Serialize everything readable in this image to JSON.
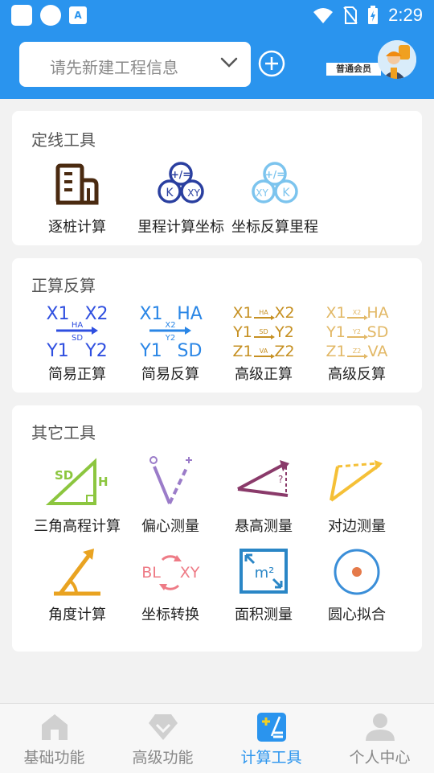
{
  "status_bar": {
    "time": "2:29"
  },
  "header": {
    "project_placeholder": "请先新建工程信息",
    "member_label": "普通会员"
  },
  "sections": [
    {
      "title": "定线工具",
      "tools": [
        {
          "label": "逐桩计算",
          "icon": "building-chart-icon"
        },
        {
          "label": "里程计算坐标",
          "icon": "k-to-xy-icon"
        },
        {
          "label": "坐标反算里程",
          "icon": "xy-to-k-icon"
        }
      ]
    },
    {
      "title": "正算反算",
      "tools": [
        {
          "label": "简易正算",
          "icon": "simple-forward-icon",
          "glyph": {
            "tl": "X1",
            "tr": "X2",
            "mid1": "HA",
            "mid2": "SD",
            "bl": "Y1",
            "br": "Y2"
          }
        },
        {
          "label": "简易反算",
          "icon": "simple-inverse-icon",
          "glyph": {
            "tl": "X1",
            "tr": "HA",
            "mid1": "X2",
            "mid2": "Y2",
            "bl": "Y1",
            "br": "SD"
          }
        },
        {
          "label": "高级正算",
          "icon": "advanced-forward-icon",
          "glyph": {
            "r1l": "X1",
            "r1r": "X2",
            "r1m": "HA",
            "r2l": "Y1",
            "r2r": "Y2",
            "r2m": "SD",
            "r3l": "Z1",
            "r3r": "Z2",
            "r3m": "VA"
          }
        },
        {
          "label": "高级反算",
          "icon": "advanced-inverse-icon",
          "glyph": {
            "r1l": "X1",
            "r1r": "HA",
            "r1m": "X2",
            "r2l": "Y1",
            "r2r": "SD",
            "r2m": "Y2",
            "r3l": "Z1",
            "r3r": "VA",
            "r3m": "Z2"
          }
        }
      ]
    },
    {
      "title": "其它工具",
      "tools": [
        {
          "label": "三角高程计算",
          "icon": "triangle-height-icon",
          "glyph": {
            "a": "SD",
            "b": "H"
          }
        },
        {
          "label": "偏心测量",
          "icon": "eccentric-measure-icon"
        },
        {
          "label": "悬高测量",
          "icon": "suspended-height-icon",
          "glyph": {
            "q": "?"
          }
        },
        {
          "label": "对边测量",
          "icon": "missing-line-icon"
        },
        {
          "label": "角度计算",
          "icon": "angle-calc-icon"
        },
        {
          "label": "坐标转换",
          "icon": "coord-convert-icon",
          "glyph": {
            "a": "BL",
            "b": "XY"
          }
        },
        {
          "label": "面积测量",
          "icon": "area-measure-icon",
          "glyph": {
            "a": "m²"
          }
        },
        {
          "label": "圆心拟合",
          "icon": "circle-fit-icon"
        }
      ]
    }
  ],
  "tabs": [
    {
      "label": "基础功能",
      "icon": "home-icon",
      "active": false
    },
    {
      "label": "高级功能",
      "icon": "diamond-icon",
      "active": false
    },
    {
      "label": "计算工具",
      "icon": "calculator-icon",
      "active": true
    },
    {
      "label": "个人中心",
      "icon": "person-icon",
      "active": false
    }
  ],
  "colors": {
    "primary": "#2a94ee",
    "blue": "#2f4fe0",
    "gold": "#c69022",
    "lightgold": "#e2b866",
    "green": "#8cc63f",
    "purple": "#8a3a6a",
    "orange": "#e9a321"
  }
}
